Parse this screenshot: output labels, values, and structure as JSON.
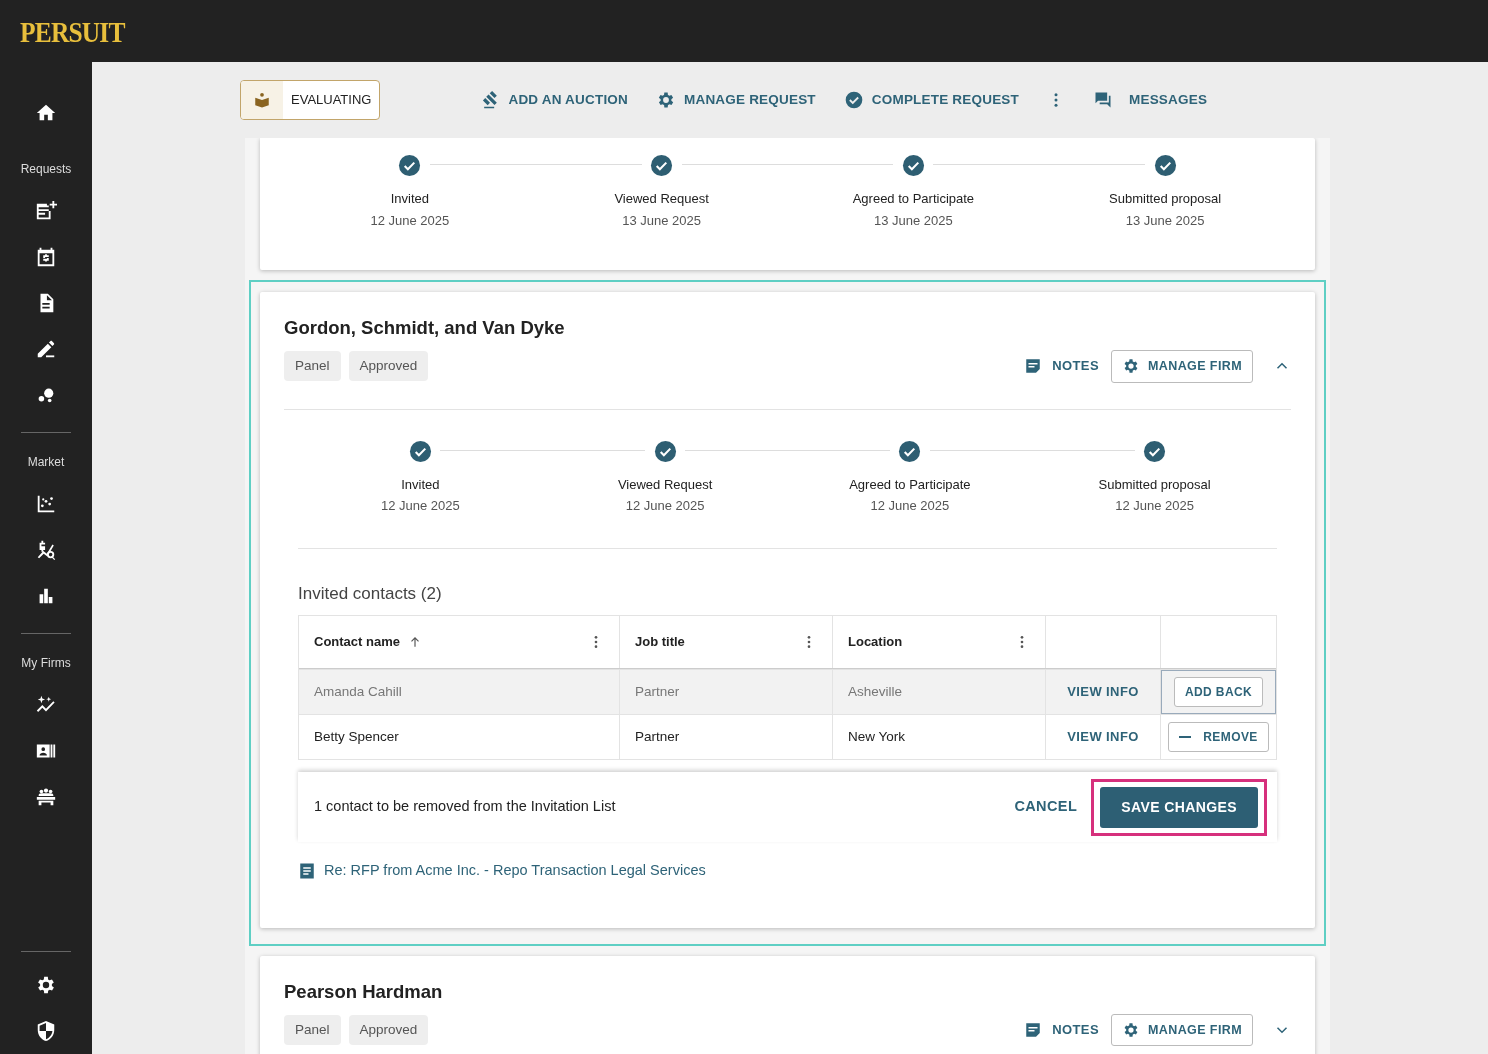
{
  "brand": "PERSUIT",
  "sidebar": {
    "sections": [
      {
        "heading": "Requests"
      },
      {
        "heading": "Market"
      },
      {
        "heading": "My Firms"
      }
    ]
  },
  "header": {
    "status": "EVALUATING",
    "actions": [
      {
        "kind": "auction",
        "label": "ADD AN AUCTION"
      },
      {
        "kind": "manage",
        "label": "MANAGE REQUEST"
      },
      {
        "kind": "complete",
        "label": "COMPLETE REQUEST"
      },
      {
        "kind": "more"
      },
      {
        "kind": "messages",
        "label": "MESSAGES"
      }
    ]
  },
  "firms": [
    {
      "steps": [
        {
          "label": "Invited",
          "date": "12 June 2025",
          "done": true
        },
        {
          "label": "Viewed Request",
          "date": "13 June 2025",
          "done": true
        },
        {
          "label": "Agreed to Participate",
          "date": "13 June 2025",
          "done": true
        },
        {
          "label": "Submitted proposal",
          "date": "13 June 2025",
          "done": true
        }
      ]
    },
    {
      "name": "Gordon, Schmidt, and Van Dyke",
      "tags": [
        "Panel",
        "Approved"
      ],
      "notes": "NOTES",
      "manage": "MANAGE FIRM",
      "expanded": true,
      "highlighted": true,
      "steps": [
        {
          "label": "Invited",
          "date": "12 June 2025",
          "done": true
        },
        {
          "label": "Viewed Request",
          "date": "12 June 2025",
          "done": true
        },
        {
          "label": "Agreed to Participate",
          "date": "12 June 2025",
          "done": true
        },
        {
          "label": "Submitted proposal",
          "date": "12 June 2025",
          "done": true
        }
      ],
      "contacts": {
        "title": "Invited contacts (2)",
        "columns": [
          {
            "label": "Contact name",
            "sorted": true
          },
          {
            "label": "Job title",
            "sorted": false
          },
          {
            "label": "Location",
            "sorted": false
          }
        ],
        "rows": [
          {
            "name": "Amanda Cahill",
            "job": "Partner",
            "location": "Asheville",
            "view": "VIEW INFO",
            "removed": true,
            "action": "ADD BACK"
          },
          {
            "name": "Betty Spencer",
            "job": "Partner",
            "location": "New York",
            "view": "VIEW INFO",
            "removed": false,
            "action": "REMOVE"
          }
        ],
        "footer": {
          "message": "1 contact to be removed from the Invitation List",
          "cancel": "CANCEL",
          "save": "SAVE CHANGES",
          "save_highlighted": true
        }
      },
      "link": "Re: RFP from Acme Inc. - Repo Transaction Legal Services"
    },
    {
      "name": "Pearson Hardman",
      "tags": [
        "Panel",
        "Approved"
      ],
      "notes": "NOTES",
      "manage": "MANAGE FIRM",
      "expanded": false,
      "highlighted": false
    }
  ]
}
